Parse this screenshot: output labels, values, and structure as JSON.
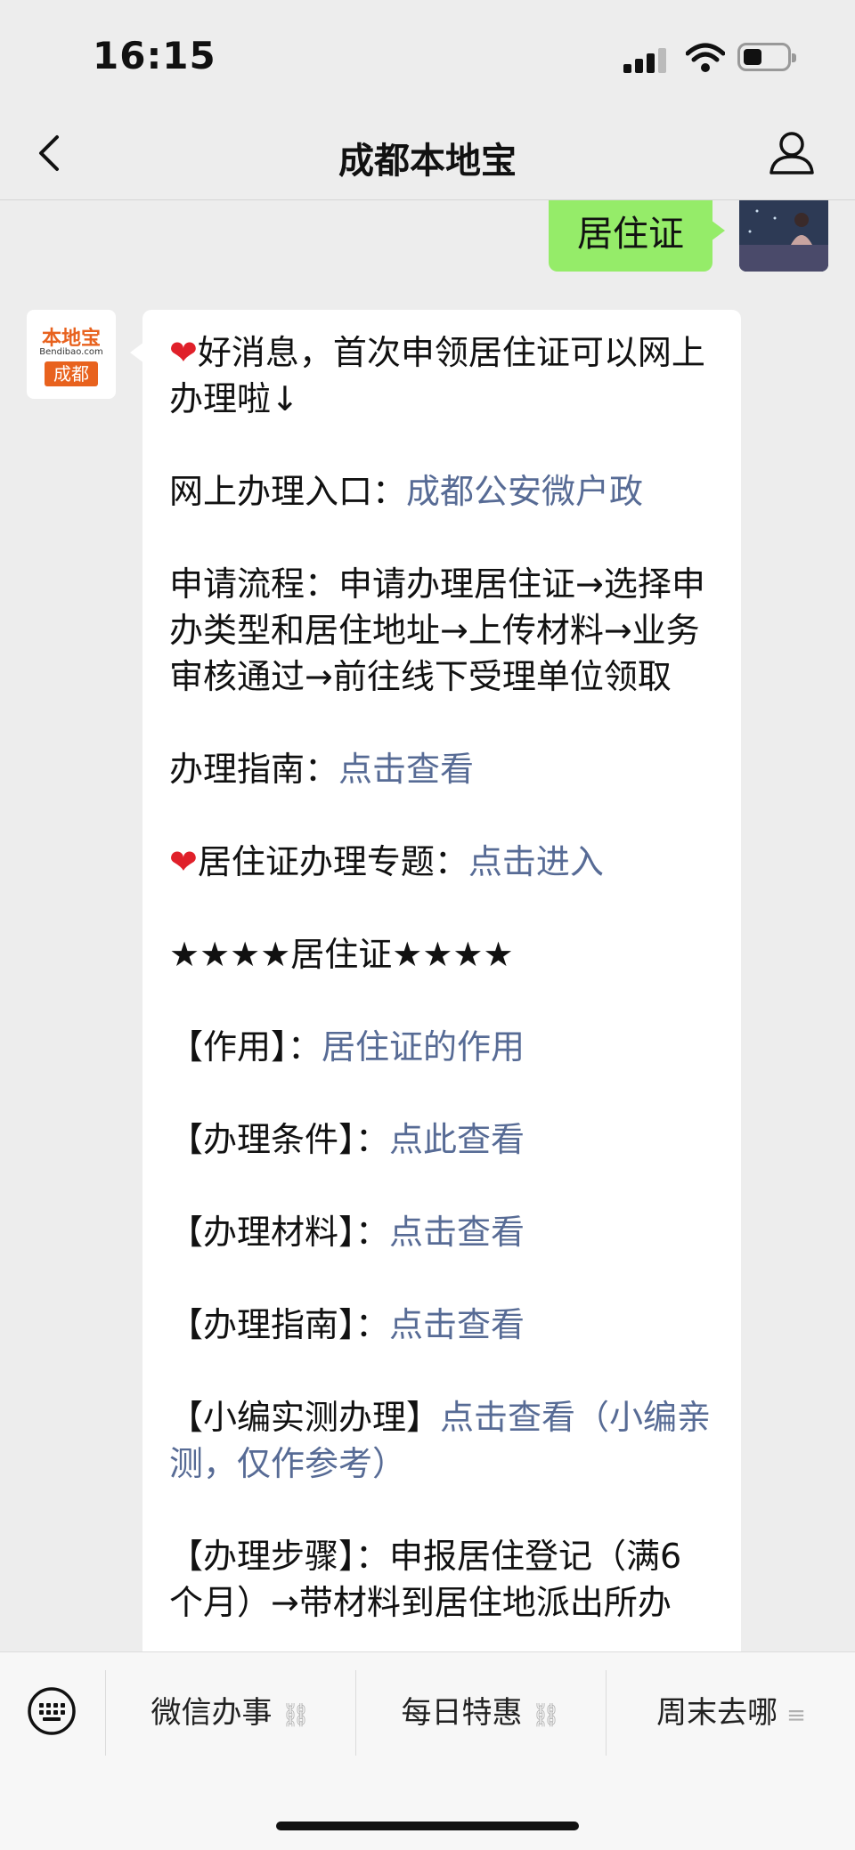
{
  "status": {
    "time": "16:15"
  },
  "nav": {
    "title": "成都本地宝"
  },
  "chat": {
    "user_message": "居住证",
    "bot_avatar": {
      "brand": "本地宝",
      "domain": "Bendibao.com",
      "city": "成都"
    },
    "lines": [
      {
        "prefix": "好消息，首次申领居住证可以网上办理啦↓",
        "link": ""
      },
      {
        "prefix": "网上办理入口：",
        "link": "成都公安微户政"
      },
      {
        "prefix": "申请流程：申请办理居住证→选择申办类型和居住地址→上传材料→业务审核通过→前往线下受理单位领取",
        "link": ""
      },
      {
        "prefix": "办理指南：",
        "link": "点击查看"
      },
      {
        "prefix": "居住证办理专题：",
        "link": "点击进入"
      },
      {
        "prefix": "★★★★居住证★★★★",
        "link": ""
      },
      {
        "prefix": "【作用】：",
        "link": "居住证的作用"
      },
      {
        "prefix": "【办理条件】：",
        "link": "点此查看"
      },
      {
        "prefix": "【办理材料】：",
        "link": "点击查看"
      },
      {
        "prefix": "【办理指南】：",
        "link": "点击查看"
      },
      {
        "prefix": "【小编实测办理】",
        "link": "点击查看（小编亲测，仅作参考）"
      },
      {
        "prefix": "【办理步骤】：申报居住登记（满6个月）→带材料到居住地派出所办",
        "link": ""
      }
    ]
  },
  "bottom_menu": [
    {
      "label": "微信办事",
      "icon": "link-icon"
    },
    {
      "label": "每日特惠",
      "icon": "link-icon"
    },
    {
      "label": "周末去哪",
      "icon": "menu-icon"
    }
  ],
  "colors": {
    "link": "#576b95",
    "user_bubble": "#95ec69"
  }
}
